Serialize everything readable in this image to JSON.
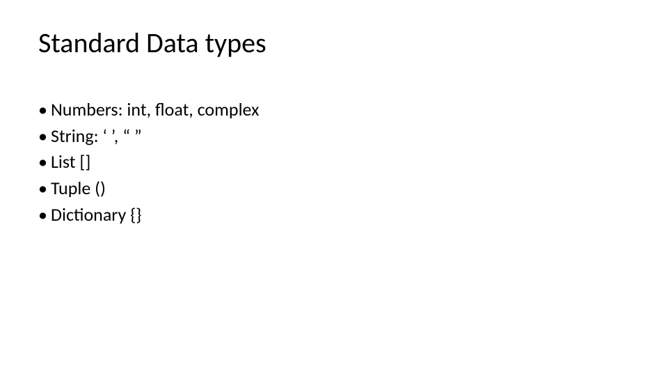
{
  "slide": {
    "title": "Standard Data types",
    "bullets": [
      "Numbers: int, float, complex",
      "String: ‘ ’, “ ”",
      "List []",
      "Tuple ()",
      "Dictionary {}"
    ]
  }
}
